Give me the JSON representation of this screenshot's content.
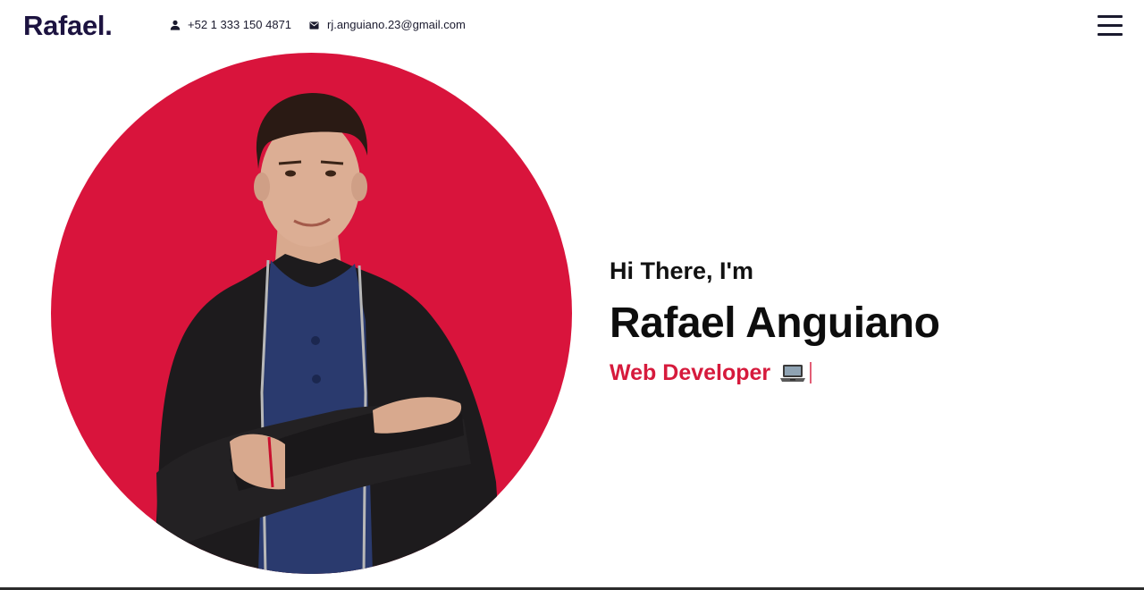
{
  "header": {
    "logo": "Rafael.",
    "phone": "+52 1 333 150 4871",
    "email": "rj.anguiano.23@gmail.com",
    "phone_icon": "person-icon",
    "email_icon": "mail-icon",
    "menu_icon": "hamburger-menu-icon"
  },
  "hero": {
    "greeting": "Hi There, I'm",
    "name": "Rafael Anguiano",
    "role": "Web Developer",
    "role_icon": "laptop-icon",
    "photo_alt": "Rafael Anguiano"
  },
  "colors": {
    "accent": "#d61a3c",
    "brand_dark": "#1c1340",
    "text": "#111111",
    "background": "#ffffff"
  }
}
